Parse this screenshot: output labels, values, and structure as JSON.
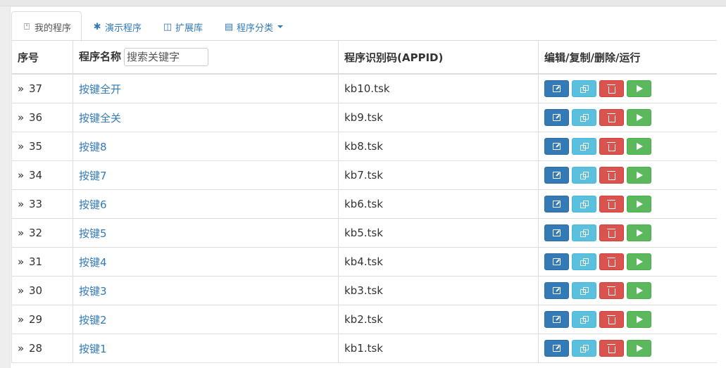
{
  "tabs": [
    {
      "icon": "bookmark-icon",
      "glyph": "⍞",
      "label": "我的程序",
      "active": true
    },
    {
      "icon": "asterisk-icon",
      "glyph": "✱",
      "label": "演示程序",
      "active": false
    },
    {
      "icon": "columns-icon",
      "glyph": "◫",
      "label": "扩展库",
      "active": false
    },
    {
      "icon": "list-alt-icon",
      "glyph": "▤",
      "label": "程序分类",
      "active": false,
      "dropdown": true
    }
  ],
  "table": {
    "headers": {
      "seq": "序号",
      "name": "程序名称",
      "appid": "程序识别码(APPID)",
      "actions": "编辑/复制/删除/运行"
    },
    "search_placeholder": "搜索关键字",
    "seq_prefix": "»",
    "rows": [
      {
        "seq": "37",
        "name": "按键全开",
        "appid": "kb10.tsk"
      },
      {
        "seq": "36",
        "name": "按键全关",
        "appid": "kb9.tsk"
      },
      {
        "seq": "35",
        "name": "按键8",
        "appid": "kb8.tsk"
      },
      {
        "seq": "34",
        "name": "按键7",
        "appid": "kb7.tsk"
      },
      {
        "seq": "33",
        "name": "按键6",
        "appid": "kb6.tsk"
      },
      {
        "seq": "32",
        "name": "按键5",
        "appid": "kb5.tsk"
      },
      {
        "seq": "31",
        "name": "按键4",
        "appid": "kb4.tsk"
      },
      {
        "seq": "30",
        "name": "按键3",
        "appid": "kb3.tsk"
      },
      {
        "seq": "29",
        "name": "按键2",
        "appid": "kb2.tsk"
      },
      {
        "seq": "28",
        "name": "按键1",
        "appid": "kb1.tsk"
      }
    ]
  },
  "colors": {
    "edit": "#337ab7",
    "copy": "#5bc0de",
    "delete": "#d9534f",
    "run": "#5cb85c",
    "link": "#337ab7"
  }
}
